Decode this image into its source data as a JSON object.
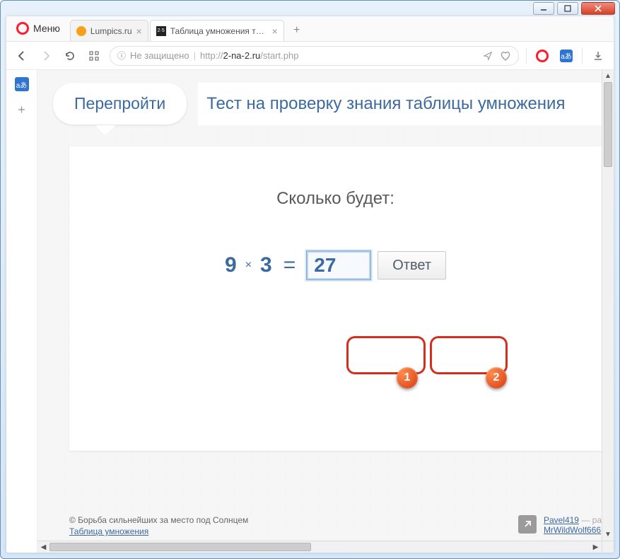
{
  "window": {
    "menu_label": "Меню"
  },
  "tabs": [
    {
      "title": "Lumpics.ru",
      "favicon_color": "#f7a11b"
    },
    {
      "title": "Таблица умножения трен",
      "favicon_text": "2·5"
    }
  ],
  "addressbar": {
    "unsafe_label": "Не защищено",
    "prefix": "http://",
    "host": "2-na-2.ru",
    "path": "/start.php"
  },
  "page": {
    "retry_label": "Перепройти",
    "title": "Тест на проверку знания таблицы умножения",
    "question_label": "Сколько будет:",
    "operand_a": "9",
    "operator": "×",
    "operand_b": "3",
    "equals": "=",
    "answer_value": "27",
    "answer_button": "Ответ"
  },
  "footer": {
    "copyright": "© Борьба сильнейших за место под Солнцем",
    "link1": "Таблица умножения",
    "user1": "Pavel419",
    "user1_suffix": " — ра",
    "user2": "MrWildWolf666"
  },
  "annotations": {
    "n1": "1",
    "n2": "2"
  }
}
